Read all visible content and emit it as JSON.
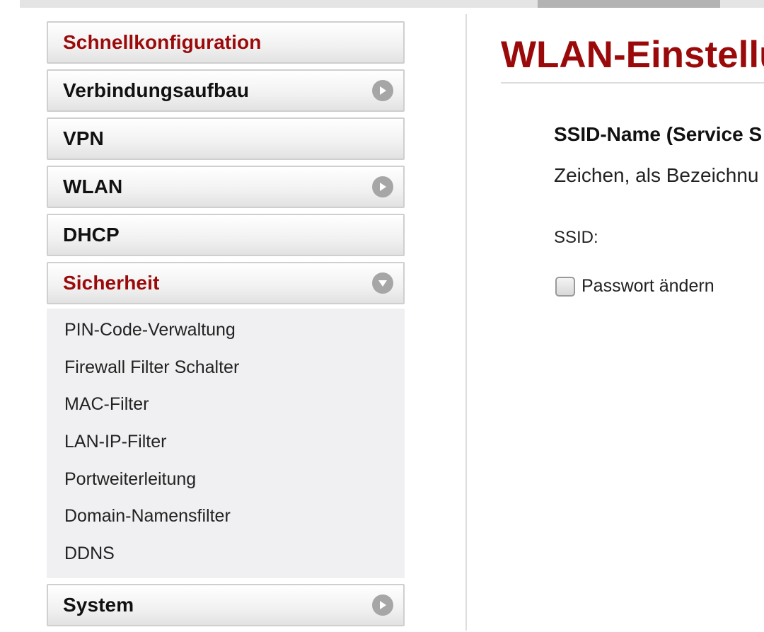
{
  "icons": {
    "collapsed_arrow": "chevron-right-circle-icon",
    "expanded_arrow": "chevron-down-circle-icon"
  },
  "colors": {
    "accent": "#9b0a0a",
    "arrow": "#a6a6a6",
    "submenu_bg": "#f0f0f2"
  },
  "sidebar": {
    "items": [
      {
        "label": "Schnellkonfiguration",
        "highlight": true,
        "arrow": "none"
      },
      {
        "label": "Verbindungsaufbau",
        "highlight": false,
        "arrow": "right"
      },
      {
        "label": "VPN",
        "highlight": false,
        "arrow": "none"
      },
      {
        "label": "WLAN",
        "highlight": false,
        "arrow": "right"
      },
      {
        "label": "DHCP",
        "highlight": false,
        "arrow": "none"
      },
      {
        "label": "Sicherheit",
        "highlight": true,
        "arrow": "down"
      },
      {
        "label": "System",
        "highlight": false,
        "arrow": "right"
      }
    ],
    "security_subitems": [
      "PIN-Code-Verwaltung",
      "Firewall Filter Schalter",
      "MAC-Filter",
      "LAN-IP-Filter",
      "Portweiterleitung",
      "Domain-Namensfilter",
      "DDNS"
    ]
  },
  "main": {
    "title": "WLAN-Einstellu",
    "ssid_heading": "SSID-Name (Service S",
    "ssid_description": "Zeichen, als Bezeichnu",
    "ssid_label": "SSID:",
    "password_checkbox_label": "Passwort ändern",
    "password_checkbox_checked": false
  }
}
